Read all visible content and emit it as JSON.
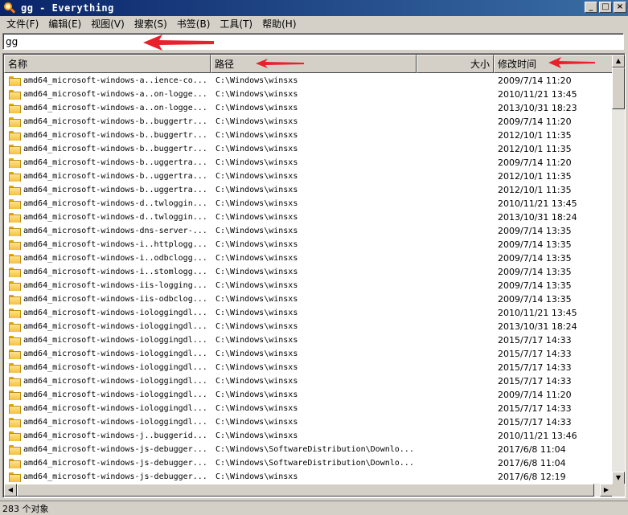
{
  "window": {
    "title": "gg - Everything"
  },
  "menu": [
    "文件(F)",
    "编辑(E)",
    "视图(V)",
    "搜索(S)",
    "书签(B)",
    "工具(T)",
    "帮助(H)"
  ],
  "search": {
    "value": "gg"
  },
  "columns": {
    "name": "名称",
    "path": "路径",
    "size": "大小",
    "modified": "修改时间"
  },
  "rows": [
    {
      "name": "amd64_microsoft-windows-a..ience-co...",
      "path": "C:\\Windows\\winsxs",
      "modified": "2009/7/14 11:20"
    },
    {
      "name": "amd64_microsoft-windows-a..on-logge...",
      "path": "C:\\Windows\\winsxs",
      "modified": "2010/11/21 13:45"
    },
    {
      "name": "amd64_microsoft-windows-a..on-logge...",
      "path": "C:\\Windows\\winsxs",
      "modified": "2013/10/31 18:23"
    },
    {
      "name": "amd64_microsoft-windows-b..buggertr...",
      "path": "C:\\Windows\\winsxs",
      "modified": "2009/7/14 11:20"
    },
    {
      "name": "amd64_microsoft-windows-b..buggertr...",
      "path": "C:\\Windows\\winsxs",
      "modified": "2012/10/1 11:35"
    },
    {
      "name": "amd64_microsoft-windows-b..buggertr...",
      "path": "C:\\Windows\\winsxs",
      "modified": "2012/10/1 11:35"
    },
    {
      "name": "amd64_microsoft-windows-b..uggertra...",
      "path": "C:\\Windows\\winsxs",
      "modified": "2009/7/14 11:20"
    },
    {
      "name": "amd64_microsoft-windows-b..uggertra...",
      "path": "C:\\Windows\\winsxs",
      "modified": "2012/10/1 11:35"
    },
    {
      "name": "amd64_microsoft-windows-b..uggertra...",
      "path": "C:\\Windows\\winsxs",
      "modified": "2012/10/1 11:35"
    },
    {
      "name": "amd64_microsoft-windows-d..twloggin...",
      "path": "C:\\Windows\\winsxs",
      "modified": "2010/11/21 13:45"
    },
    {
      "name": "amd64_microsoft-windows-d..twloggin...",
      "path": "C:\\Windows\\winsxs",
      "modified": "2013/10/31 18:24"
    },
    {
      "name": "amd64_microsoft-windows-dns-server-...",
      "path": "C:\\Windows\\winsxs",
      "modified": "2009/7/14 13:35"
    },
    {
      "name": "amd64_microsoft-windows-i..httplogg...",
      "path": "C:\\Windows\\winsxs",
      "modified": "2009/7/14 13:35"
    },
    {
      "name": "amd64_microsoft-windows-i..odbclogg...",
      "path": "C:\\Windows\\winsxs",
      "modified": "2009/7/14 13:35"
    },
    {
      "name": "amd64_microsoft-windows-i..stomlogg...",
      "path": "C:\\Windows\\winsxs",
      "modified": "2009/7/14 13:35"
    },
    {
      "name": "amd64_microsoft-windows-iis-logging...",
      "path": "C:\\Windows\\winsxs",
      "modified": "2009/7/14 13:35"
    },
    {
      "name": "amd64_microsoft-windows-iis-odbclog...",
      "path": "C:\\Windows\\winsxs",
      "modified": "2009/7/14 13:35"
    },
    {
      "name": "amd64_microsoft-windows-iologgingdl...",
      "path": "C:\\Windows\\winsxs",
      "modified": "2010/11/21 13:45"
    },
    {
      "name": "amd64_microsoft-windows-iologgingdl...",
      "path": "C:\\Windows\\winsxs",
      "modified": "2013/10/31 18:24"
    },
    {
      "name": "amd64_microsoft-windows-iologgingdl...",
      "path": "C:\\Windows\\winsxs",
      "modified": "2015/7/17 14:33"
    },
    {
      "name": "amd64_microsoft-windows-iologgingdl...",
      "path": "C:\\Windows\\winsxs",
      "modified": "2015/7/17 14:33"
    },
    {
      "name": "amd64_microsoft-windows-iologgingdl...",
      "path": "C:\\Windows\\winsxs",
      "modified": "2015/7/17 14:33"
    },
    {
      "name": "amd64_microsoft-windows-iologgingdl...",
      "path": "C:\\Windows\\winsxs",
      "modified": "2015/7/17 14:33"
    },
    {
      "name": "amd64_microsoft-windows-iologgingdl...",
      "path": "C:\\Windows\\winsxs",
      "modified": "2009/7/14 11:20"
    },
    {
      "name": "amd64_microsoft-windows-iologgingdl...",
      "path": "C:\\Windows\\winsxs",
      "modified": "2015/7/17 14:33"
    },
    {
      "name": "amd64_microsoft-windows-iologgingdl...",
      "path": "C:\\Windows\\winsxs",
      "modified": "2015/7/17 14:33"
    },
    {
      "name": "amd64_microsoft-windows-j..buggerid...",
      "path": "C:\\Windows\\winsxs",
      "modified": "2010/11/21 13:46"
    },
    {
      "name": "amd64_microsoft-windows-js-debugger...",
      "path": "C:\\Windows\\SoftwareDistribution\\Downlo...",
      "modified": "2017/6/8 11:04"
    },
    {
      "name": "amd64_microsoft-windows-js-debugger...",
      "path": "C:\\Windows\\SoftwareDistribution\\Downlo...",
      "modified": "2017/6/8 11:04"
    },
    {
      "name": "amd64_microsoft-windows-js-debugger...",
      "path": "C:\\Windows\\winsxs",
      "modified": "2017/6/8 12:19"
    }
  ],
  "status": {
    "text": "283 个对象"
  },
  "colors": {
    "annotation_arrow": "#e8212b",
    "title_gradient_start": "#0a246a",
    "title_gradient_end": "#3a6ea5"
  }
}
